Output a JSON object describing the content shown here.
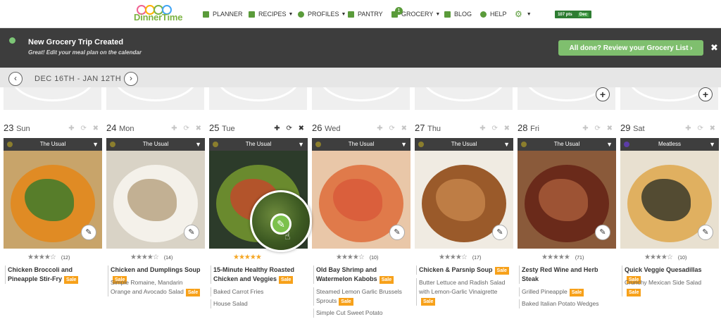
{
  "brand": {
    "logo_text": "DinnerTime",
    "logo_colors": [
      "#f06292",
      "#ffb300",
      "#7cb342",
      "#42a5f5"
    ]
  },
  "nav": {
    "planner": "PLANNER",
    "recipes": "RECIPES",
    "profiles": "PROFILES",
    "pantry": "PANTRY",
    "grocery": "GROCERY",
    "grocery_badge": "1",
    "blog": "BLOG",
    "help": "HELP",
    "points": "107 pts",
    "points_month": "Dec"
  },
  "banner": {
    "title": "New Grocery Trip Created",
    "subtitle": "Great! Edit your meal plan on the calendar",
    "button": "All done? Review your Grocery List ›",
    "close": "✖"
  },
  "datebar": {
    "range": "DEC 16TH - JAN 12TH",
    "prev": "‹",
    "next": "›"
  },
  "days": [
    {
      "num": "23",
      "dow": "Sun",
      "meal_type": "The Usual",
      "rating": 4,
      "count": "(12)",
      "recipe": "Chicken Broccoli and Pineapple Stir-Fry",
      "recipe_sale": "Sale",
      "sides": [],
      "acts": "✚ ⟳ ✖"
    },
    {
      "num": "24",
      "dow": "Mon",
      "meal_type": "The Usual",
      "rating": 4,
      "count": "(14)",
      "recipe": "Chicken and Dumplings Soup",
      "recipe_sale": "Sale",
      "sides": [
        {
          "name": "Simple Romaine, Mandarin Orange and Avocado Salad",
          "sale": "Sale"
        }
      ],
      "acts": "✚ ⟳ ✖"
    },
    {
      "num": "25",
      "dow": "Tue",
      "meal_type": "The Usual",
      "rating": 5,
      "count": "",
      "recipe": "15-Minute Healthy Roasted Chicken and Veggies",
      "recipe_sale": "Sale",
      "sides": [
        {
          "name": "Baked Carrot Fries",
          "sale": ""
        },
        {
          "name": "House Salad",
          "sale": ""
        }
      ],
      "acts": "✚ ⟳ ✖"
    },
    {
      "num": "26",
      "dow": "Wed",
      "meal_type": "The Usual",
      "rating": 4,
      "count": "(10)",
      "recipe": "Old Bay Shrimp and Watermelon Kabobs",
      "recipe_sale": "Sale",
      "sides": [
        {
          "name": "Steamed Lemon Garlic Brussels Sprouts",
          "sale": "Sale"
        },
        {
          "name": "Simple Cut Sweet Potato",
          "sale": ""
        }
      ],
      "acts": "✚ ⟳ ✖"
    },
    {
      "num": "27",
      "dow": "Thu",
      "meal_type": "The Usual",
      "rating": 4,
      "count": "(17)",
      "recipe": "Chicken & Parsnip Soup",
      "recipe_sale": "Sale",
      "sides": [
        {
          "name": "Butter Lettuce and Radish Salad with Lemon-Garlic Vinaigrette",
          "sale": "Sale"
        }
      ],
      "acts": "✚ ⟳ ✖"
    },
    {
      "num": "28",
      "dow": "Fri",
      "meal_type": "The Usual",
      "rating": 4.5,
      "count": "(71)",
      "recipe": "Zesty Red Wine and Herb Steak",
      "recipe_sale": "",
      "sides": [
        {
          "name": "Grilled Pineapple",
          "sale": "Sale"
        },
        {
          "name": "Baked Italian Potato Wedges",
          "sale": ""
        }
      ],
      "acts": "✚ ⟳ ✖"
    },
    {
      "num": "29",
      "dow": "Sat",
      "meal_type": "Meatless",
      "rating": 4,
      "count": "(10)",
      "recipe": "Quick Veggie Quesadillas",
      "recipe_sale": "Sale",
      "sides": [
        {
          "name": "Crunchy Mexican Side Salad",
          "sale": "Sale"
        }
      ],
      "acts": "✚ ⟳ ✖"
    }
  ],
  "colors": {
    "accent": "#5a9b3a",
    "sale": "#f7a11a",
    "banner_bg": "#3d3d3d",
    "button_green": "#7fbf6e"
  }
}
